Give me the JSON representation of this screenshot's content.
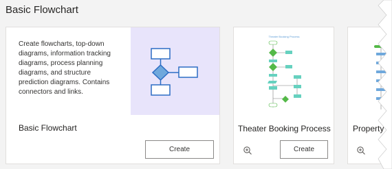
{
  "section": {
    "title": "Basic Flowchart"
  },
  "templates": [
    {
      "description": "Create flowcharts, top-down diagrams, information tracking diagrams, process planning diagrams, and structure prediction diagrams. Contains connectors and links.",
      "title": "Basic Flowchart",
      "create_label": "Create",
      "preview_bg": "#e8e4fb"
    },
    {
      "title": "Theater Booking Process",
      "create_label": "Create",
      "zoom_icon": "zoom-in-icon",
      "thumbnail_title": "Theater Booking Process"
    },
    {
      "title": "Property",
      "zoom_icon": "zoom-in-icon"
    }
  ],
  "colors": {
    "accent_blue": "#2b7cd3",
    "shape_fill": "#6fa8dc",
    "green": "#54b948",
    "teal": "#66d1bf"
  }
}
